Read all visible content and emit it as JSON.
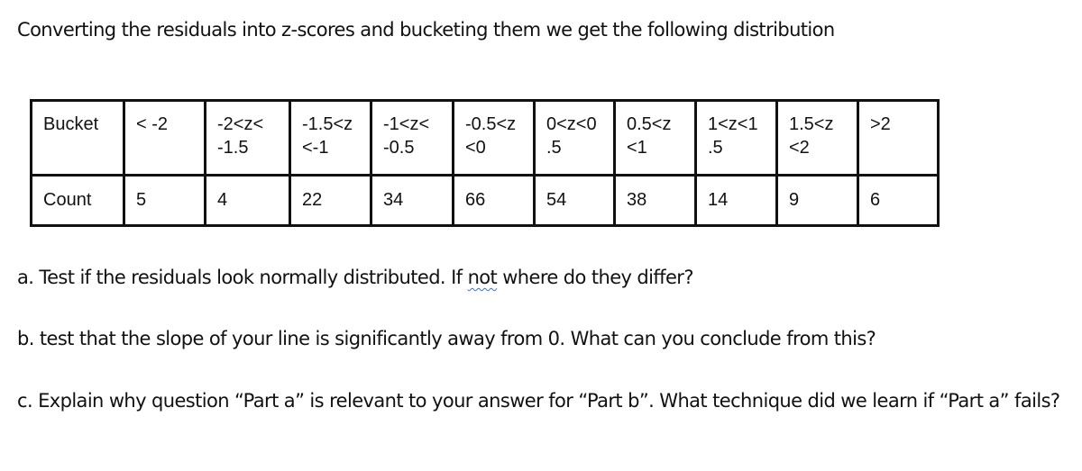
{
  "intro": "Converting the residuals into z-scores and bucketing them we get the following distribution",
  "table": {
    "bucket_header": "Bucket",
    "count_header": "Count",
    "buckets": [
      {
        "label": "< -2",
        "count": "5"
      },
      {
        "label": "-2<z<\n-1.5",
        "count": "4"
      },
      {
        "label": "-1.5<z\n<-1",
        "count": "22"
      },
      {
        "label": "-1<z<\n-0.5",
        "count": "34"
      },
      {
        "label": "-0.5<z\n<0",
        "count": "66"
      },
      {
        "label": "0<z<0\n.5",
        "count": "54"
      },
      {
        "label": "0.5<z\n<1",
        "count": "38"
      },
      {
        "label": "1<z<1\n.5",
        "count": "14"
      },
      {
        "label": "1.5<z\n<2",
        "count": "9"
      },
      {
        "label": ">2",
        "count": "6"
      }
    ]
  },
  "questions": {
    "a_before": "a. Test if the residuals look normally distributed. If ",
    "a_flagged_word": "not",
    "a_after": " where do they differ?",
    "b": "b. test that the slope of your line is significantly away from 0. What can you conclude from this?",
    "c": "c. Explain why question “Part a” is relevant to your answer for “Part b”. What technique did we learn if “Part a” fails?"
  },
  "colors": {
    "spellcheck_underline": "#3b6fd6",
    "table_border": "#111111"
  }
}
